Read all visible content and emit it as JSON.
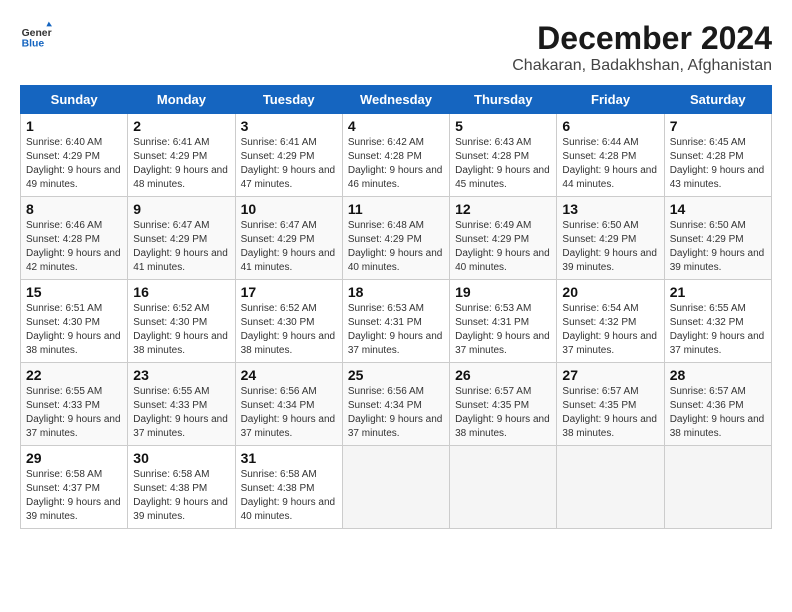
{
  "logo": {
    "general": "General",
    "blue": "Blue"
  },
  "title": "December 2024",
  "location": "Chakaran, Badakhshan, Afghanistan",
  "days_of_week": [
    "Sunday",
    "Monday",
    "Tuesday",
    "Wednesday",
    "Thursday",
    "Friday",
    "Saturday"
  ],
  "weeks": [
    [
      {
        "day": "1",
        "sunrise": "6:40 AM",
        "sunset": "4:29 PM",
        "daylight": "9 hours and 49 minutes."
      },
      {
        "day": "2",
        "sunrise": "6:41 AM",
        "sunset": "4:29 PM",
        "daylight": "9 hours and 48 minutes."
      },
      {
        "day": "3",
        "sunrise": "6:41 AM",
        "sunset": "4:29 PM",
        "daylight": "9 hours and 47 minutes."
      },
      {
        "day": "4",
        "sunrise": "6:42 AM",
        "sunset": "4:28 PM",
        "daylight": "9 hours and 46 minutes."
      },
      {
        "day": "5",
        "sunrise": "6:43 AM",
        "sunset": "4:28 PM",
        "daylight": "9 hours and 45 minutes."
      },
      {
        "day": "6",
        "sunrise": "6:44 AM",
        "sunset": "4:28 PM",
        "daylight": "9 hours and 44 minutes."
      },
      {
        "day": "7",
        "sunrise": "6:45 AM",
        "sunset": "4:28 PM",
        "daylight": "9 hours and 43 minutes."
      }
    ],
    [
      {
        "day": "8",
        "sunrise": "6:46 AM",
        "sunset": "4:28 PM",
        "daylight": "9 hours and 42 minutes."
      },
      {
        "day": "9",
        "sunrise": "6:47 AM",
        "sunset": "4:29 PM",
        "daylight": "9 hours and 41 minutes."
      },
      {
        "day": "10",
        "sunrise": "6:47 AM",
        "sunset": "4:29 PM",
        "daylight": "9 hours and 41 minutes."
      },
      {
        "day": "11",
        "sunrise": "6:48 AM",
        "sunset": "4:29 PM",
        "daylight": "9 hours and 40 minutes."
      },
      {
        "day": "12",
        "sunrise": "6:49 AM",
        "sunset": "4:29 PM",
        "daylight": "9 hours and 40 minutes."
      },
      {
        "day": "13",
        "sunrise": "6:50 AM",
        "sunset": "4:29 PM",
        "daylight": "9 hours and 39 minutes."
      },
      {
        "day": "14",
        "sunrise": "6:50 AM",
        "sunset": "4:29 PM",
        "daylight": "9 hours and 39 minutes."
      }
    ],
    [
      {
        "day": "15",
        "sunrise": "6:51 AM",
        "sunset": "4:30 PM",
        "daylight": "9 hours and 38 minutes."
      },
      {
        "day": "16",
        "sunrise": "6:52 AM",
        "sunset": "4:30 PM",
        "daylight": "9 hours and 38 minutes."
      },
      {
        "day": "17",
        "sunrise": "6:52 AM",
        "sunset": "4:30 PM",
        "daylight": "9 hours and 38 minutes."
      },
      {
        "day": "18",
        "sunrise": "6:53 AM",
        "sunset": "4:31 PM",
        "daylight": "9 hours and 37 minutes."
      },
      {
        "day": "19",
        "sunrise": "6:53 AM",
        "sunset": "4:31 PM",
        "daylight": "9 hours and 37 minutes."
      },
      {
        "day": "20",
        "sunrise": "6:54 AM",
        "sunset": "4:32 PM",
        "daylight": "9 hours and 37 minutes."
      },
      {
        "day": "21",
        "sunrise": "6:55 AM",
        "sunset": "4:32 PM",
        "daylight": "9 hours and 37 minutes."
      }
    ],
    [
      {
        "day": "22",
        "sunrise": "6:55 AM",
        "sunset": "4:33 PM",
        "daylight": "9 hours and 37 minutes."
      },
      {
        "day": "23",
        "sunrise": "6:55 AM",
        "sunset": "4:33 PM",
        "daylight": "9 hours and 37 minutes."
      },
      {
        "day": "24",
        "sunrise": "6:56 AM",
        "sunset": "4:34 PM",
        "daylight": "9 hours and 37 minutes."
      },
      {
        "day": "25",
        "sunrise": "6:56 AM",
        "sunset": "4:34 PM",
        "daylight": "9 hours and 37 minutes."
      },
      {
        "day": "26",
        "sunrise": "6:57 AM",
        "sunset": "4:35 PM",
        "daylight": "9 hours and 38 minutes."
      },
      {
        "day": "27",
        "sunrise": "6:57 AM",
        "sunset": "4:35 PM",
        "daylight": "9 hours and 38 minutes."
      },
      {
        "day": "28",
        "sunrise": "6:57 AM",
        "sunset": "4:36 PM",
        "daylight": "9 hours and 38 minutes."
      }
    ],
    [
      {
        "day": "29",
        "sunrise": "6:58 AM",
        "sunset": "4:37 PM",
        "daylight": "9 hours and 39 minutes."
      },
      {
        "day": "30",
        "sunrise": "6:58 AM",
        "sunset": "4:38 PM",
        "daylight": "9 hours and 39 minutes."
      },
      {
        "day": "31",
        "sunrise": "6:58 AM",
        "sunset": "4:38 PM",
        "daylight": "9 hours and 40 minutes."
      },
      null,
      null,
      null,
      null
    ]
  ]
}
